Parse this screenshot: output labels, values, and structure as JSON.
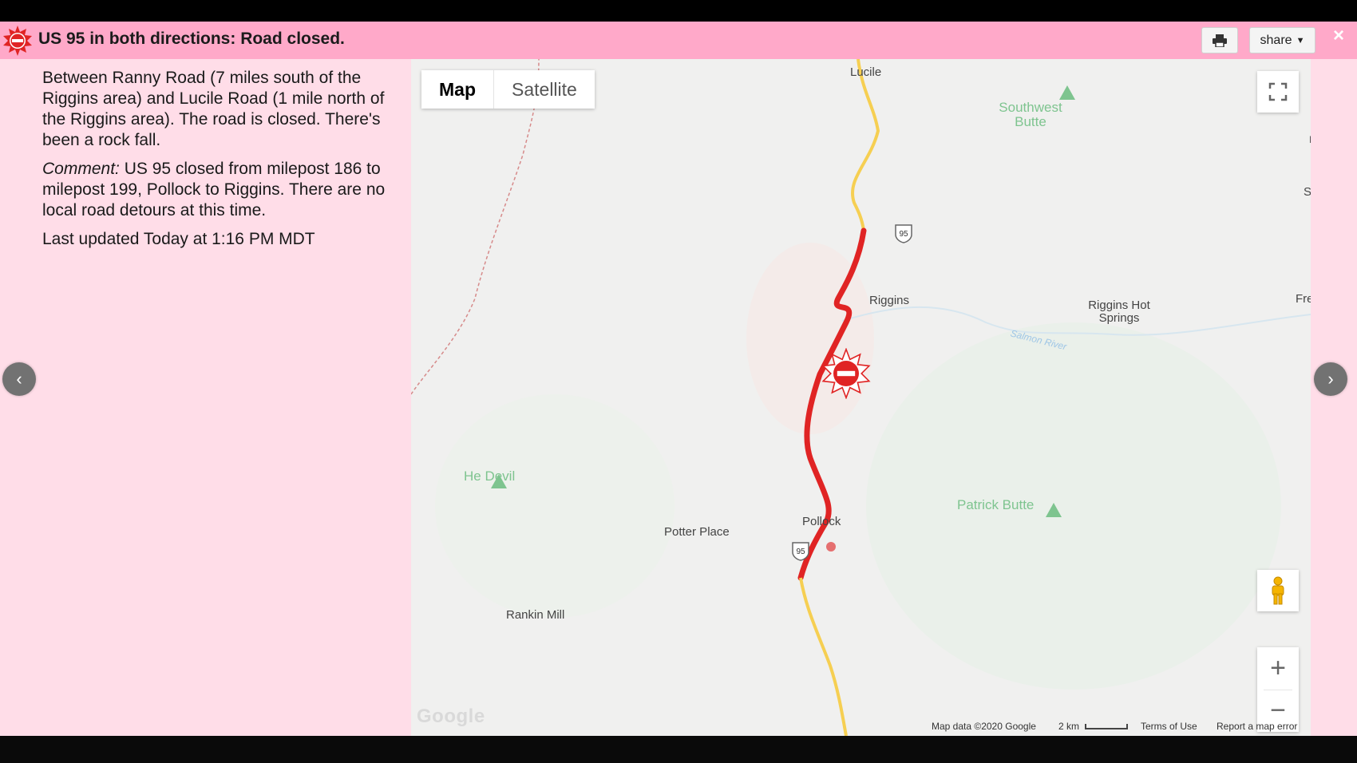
{
  "header": {
    "title": "US 95 in both directions: Road closed.",
    "print_icon": "print-icon",
    "share_label": "share",
    "close_label": "×"
  },
  "info": {
    "description": "Between Ranny Road (7 miles south of the Riggins area) and Lucile Road (1 mile north of the Riggins area). The road is closed. There's been a rock fall.",
    "comment_label": "Comment:",
    "comment_text": " US 95 closed from milepost 186 to milepost 199, Pollock to Riggins. There are no local road detours at this time.",
    "last_updated": "Last updated Today at 1:16 PM MDT"
  },
  "nav": {
    "prev_icon": "chevron-left-icon",
    "next_icon": "chevron-right-icon"
  },
  "map": {
    "toggle": {
      "map_label": "Map",
      "satellite_label": "Satellite"
    },
    "places": {
      "lucile": "Lucile",
      "southwest_butte": "Southwest Butte",
      "riggins": "Riggins",
      "riggins_hot_springs": "Riggins Hot Springs",
      "salmon_river": "Salmon River",
      "he_devil": "He Devil",
      "patrick_butte": "Patrick Butte",
      "pollock": "Pollock",
      "potter_place": "Potter Place",
      "rankin_mill": "Rankin Mill",
      "edge_fre": "Fre",
      "edge_s": "S",
      "edge_i": "I"
    },
    "highway_shield": "95",
    "google_logo": "Google",
    "attribution": {
      "map_data": "Map data ©2020 Google",
      "scale": "2 km",
      "terms": "Terms of Use",
      "report": "Report a map error"
    },
    "zoom_in": "+",
    "zoom_out": "−"
  },
  "colors": {
    "header_bg": "#ffa9c9",
    "panel_bg": "#ffdde8",
    "closure_red": "#e02424",
    "road_yellow": "#f6cf52"
  }
}
